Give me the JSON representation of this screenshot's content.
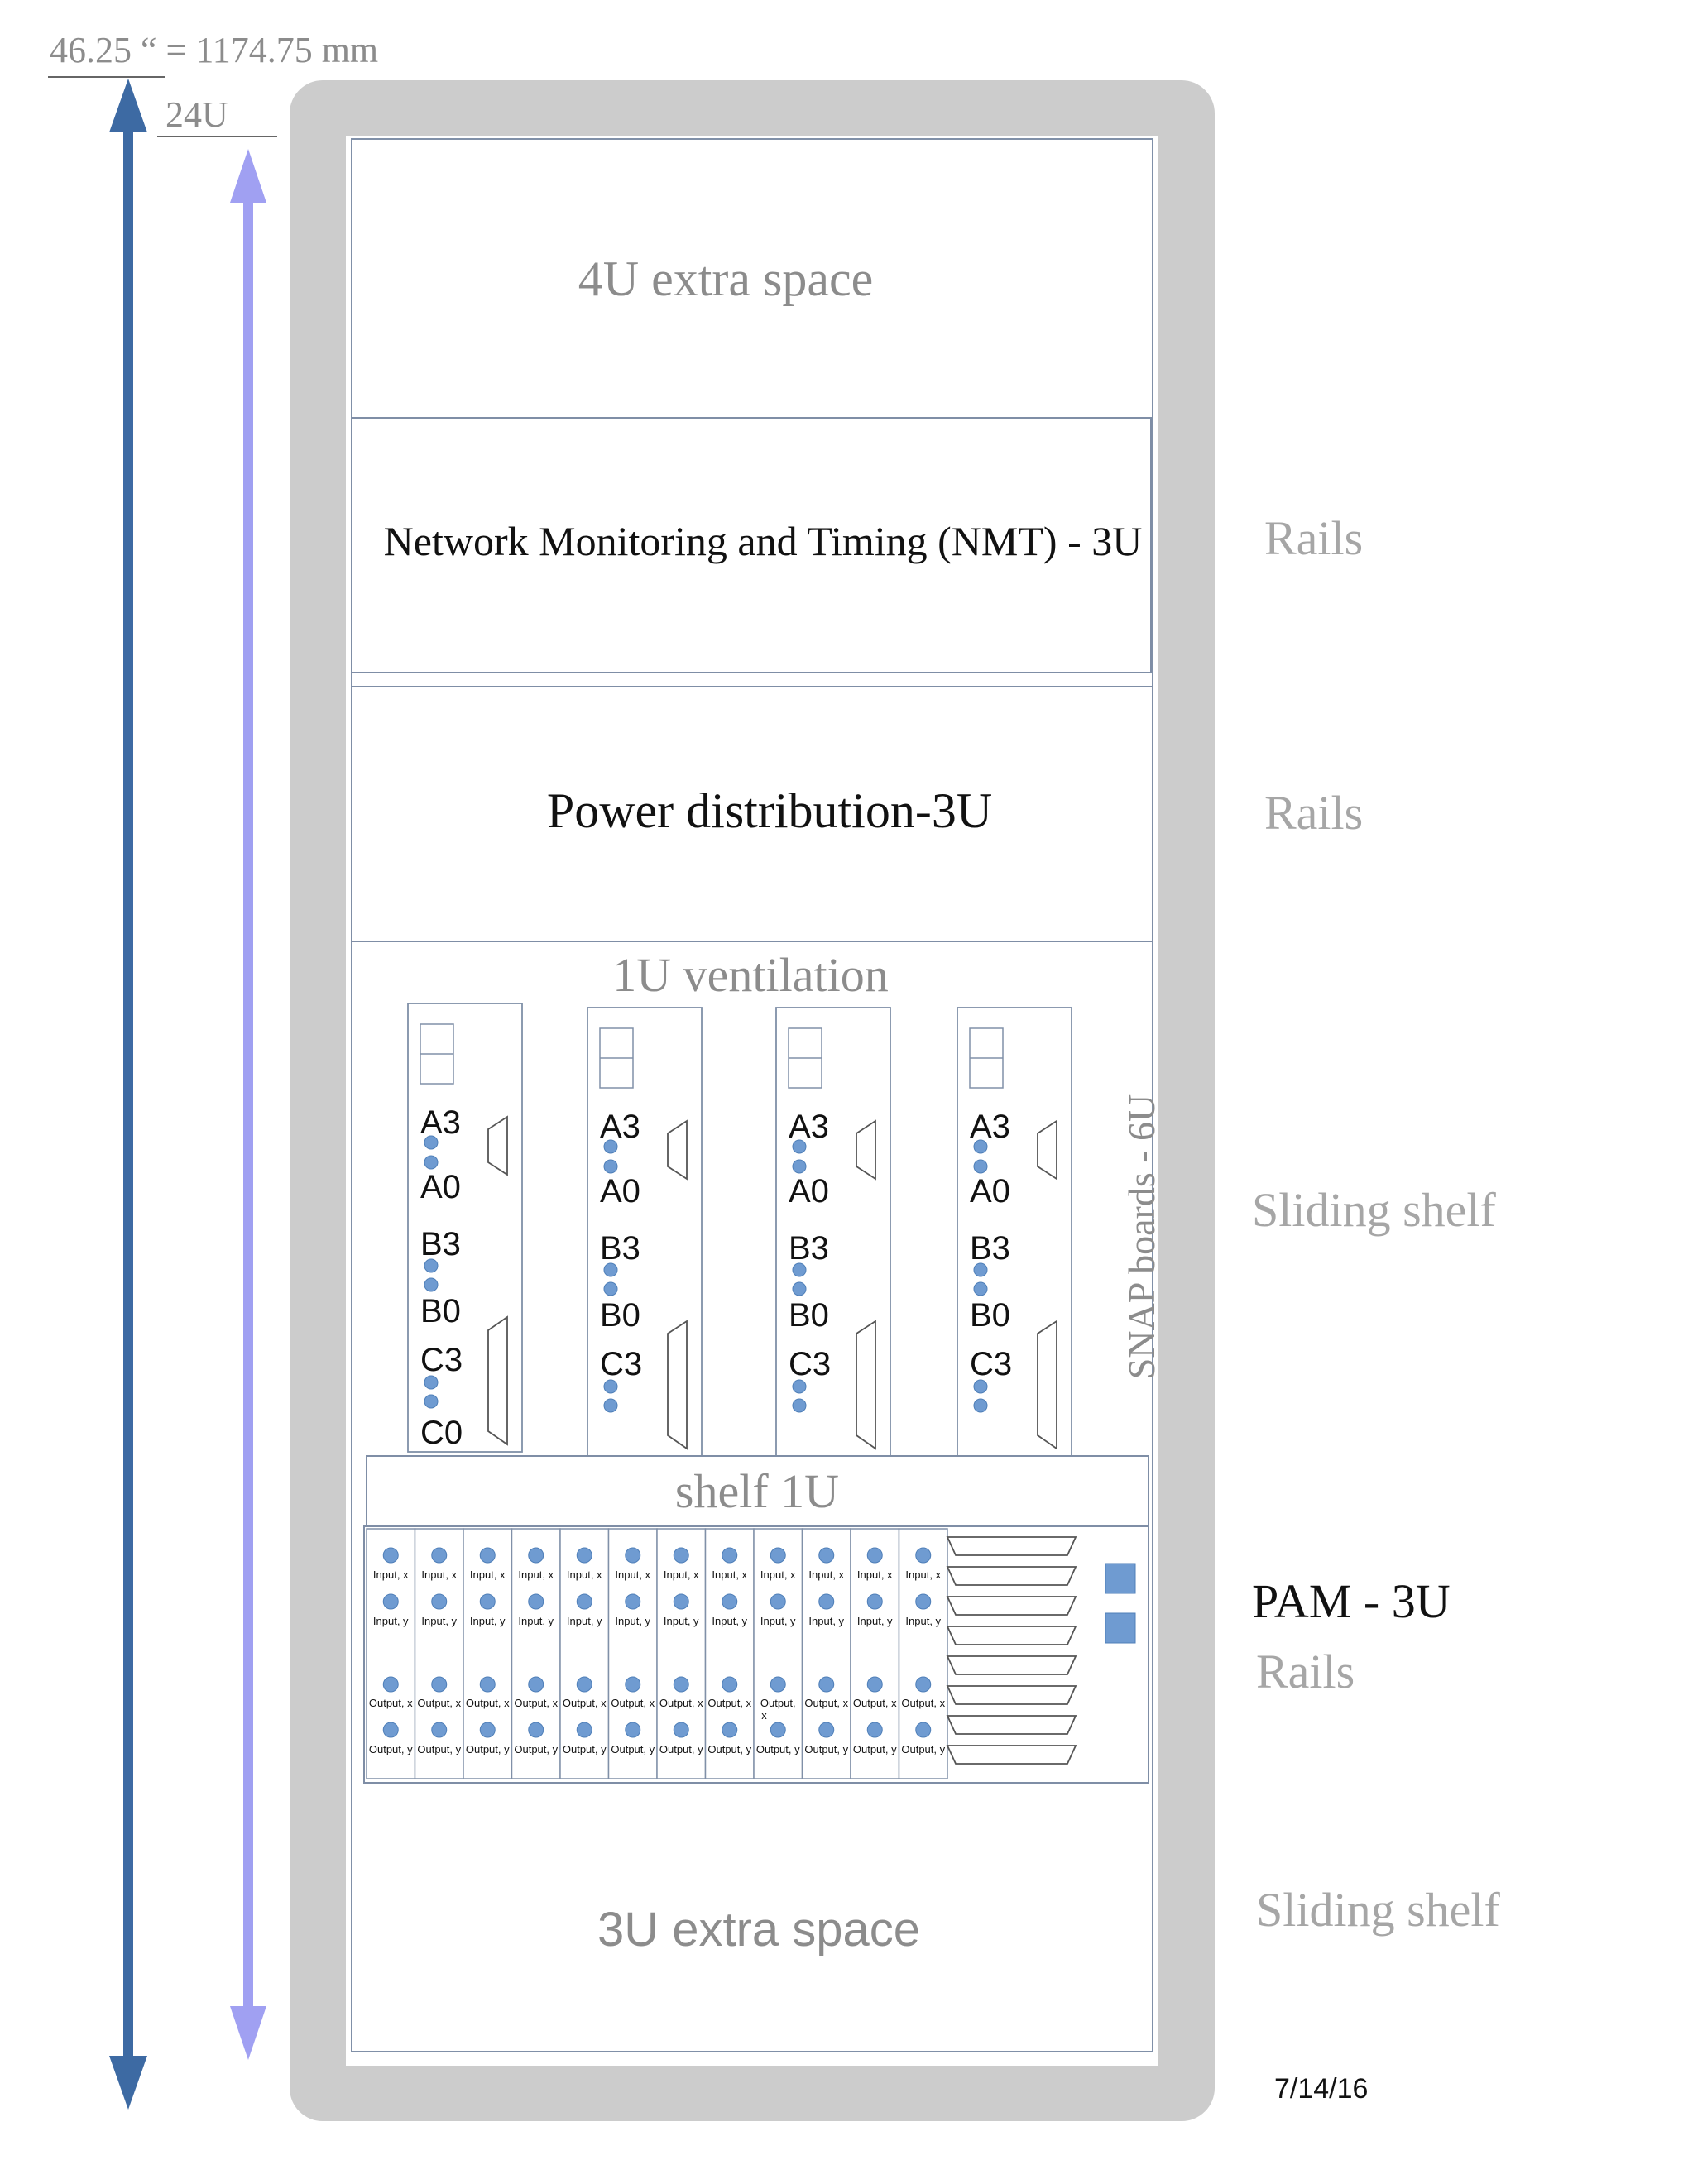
{
  "dimensions": {
    "overall": "46.25 “ = 1174.75 mm",
    "units": "24U"
  },
  "sections": {
    "top_extra": "4U extra space",
    "nmt": "Network Monitoring and Timing (NMT) - 3U",
    "power": "Power distribution-3U",
    "ventilation": "1U ventilation",
    "snap_label": "SNAP boards - 6U",
    "shelf": "shelf 1U",
    "bottom_extra": "3U extra space"
  },
  "snap_boards": {
    "board1": [
      "A3",
      "A0",
      "B3",
      "B0",
      "C3",
      "C0"
    ],
    "board2": [
      "A3",
      "A0",
      "B3",
      "B0",
      "C3"
    ],
    "board3": [
      "A3",
      "A0",
      "B3",
      "B0",
      "C3"
    ],
    "board4": [
      "A3",
      "A0",
      "B3",
      "B0",
      "C3"
    ]
  },
  "pam": {
    "input_x": "Input, x",
    "input_y": "Input, y",
    "output_x": "Output, x",
    "output_y": "Output, y",
    "output_x_split_a": "Output,",
    "output_x_split_b": "x"
  },
  "side_labels": {
    "nmt": "Rails",
    "power": "Rails",
    "snap": "Sliding shelf",
    "pam": "PAM - 3U",
    "pam_rails": "Rails",
    "bottom": "Sliding shelf"
  },
  "date": "7/14/16",
  "colors": {
    "cabinet": "#cccccc",
    "arrow_outer": "#3d6aa3",
    "arrow_inner": "#a0a0f2",
    "connector_dot": "#6f9bd1",
    "pam_square": "#6f9bd1"
  }
}
